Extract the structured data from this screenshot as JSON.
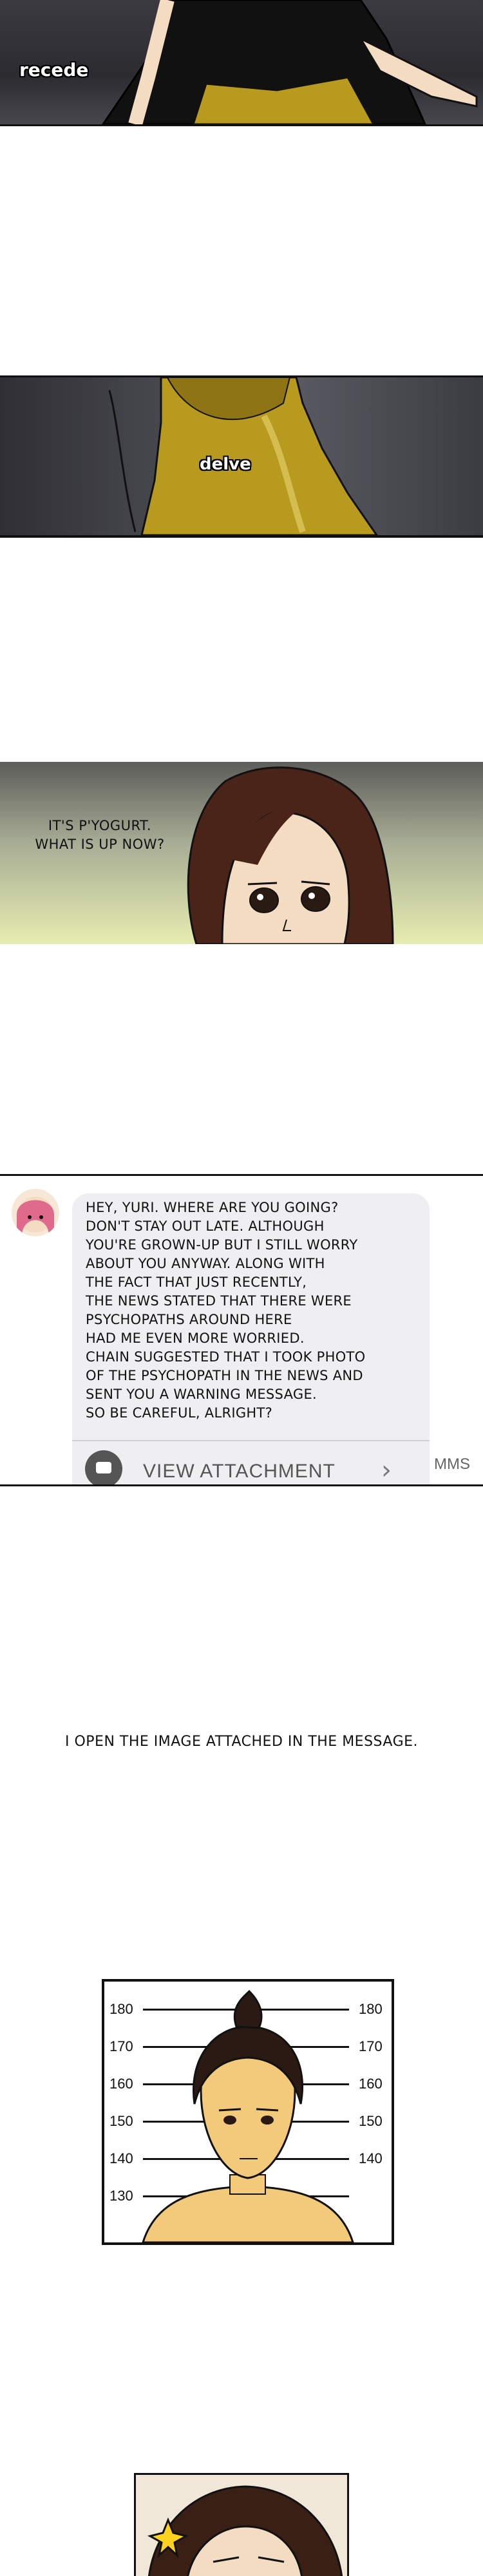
{
  "panels": {
    "recede": {
      "sfx": "recede"
    },
    "delve": {
      "sfx": "delve"
    },
    "pyogurt": {
      "speech": "IT'S P'YOGURT.\nWHAT IS UP NOW?"
    },
    "message": {
      "text": "HEY, YURI. WHERE ARE YOU GOING?\nDON'T STAY OUT LATE. ALTHOUGH\nYOU'RE GROWN-UP BUT I STILL WORRY\nABOUT YOU ANYWAY. ALONG WITH\nTHE FACT THAT JUST RECENTLY,\nTHE NEWS STATED THAT THERE WERE\nPSYCHOPATHS AROUND HERE\nHAD ME EVEN MORE WORRIED.\nCHAIN SUGGESTED THAT I TOOK PHOTO\nOF THE PSYCHOPATH IN THE NEWS AND\nSENT YOU A WARNING MESSAGE.\nSO BE CAREFUL, ALRIGHT?",
      "attachment_label": "VIEW ATTACHMENT",
      "type_label": "MMS"
    },
    "narration": {
      "text": "I OPEN THE IMAGE ATTACHED IN THE MESSAGE."
    },
    "mugshot": {
      "heights_left": [
        "180",
        "170",
        "160",
        "150",
        "140",
        "130"
      ],
      "heights_right": [
        "180",
        "170",
        "160",
        "150",
        "140"
      ]
    }
  },
  "colors": {
    "shirt_mustard": "#b89a1e",
    "hair_brown": "#4a2418",
    "skin": "#f3dcc2",
    "bubble_gray": "#efeff1"
  }
}
